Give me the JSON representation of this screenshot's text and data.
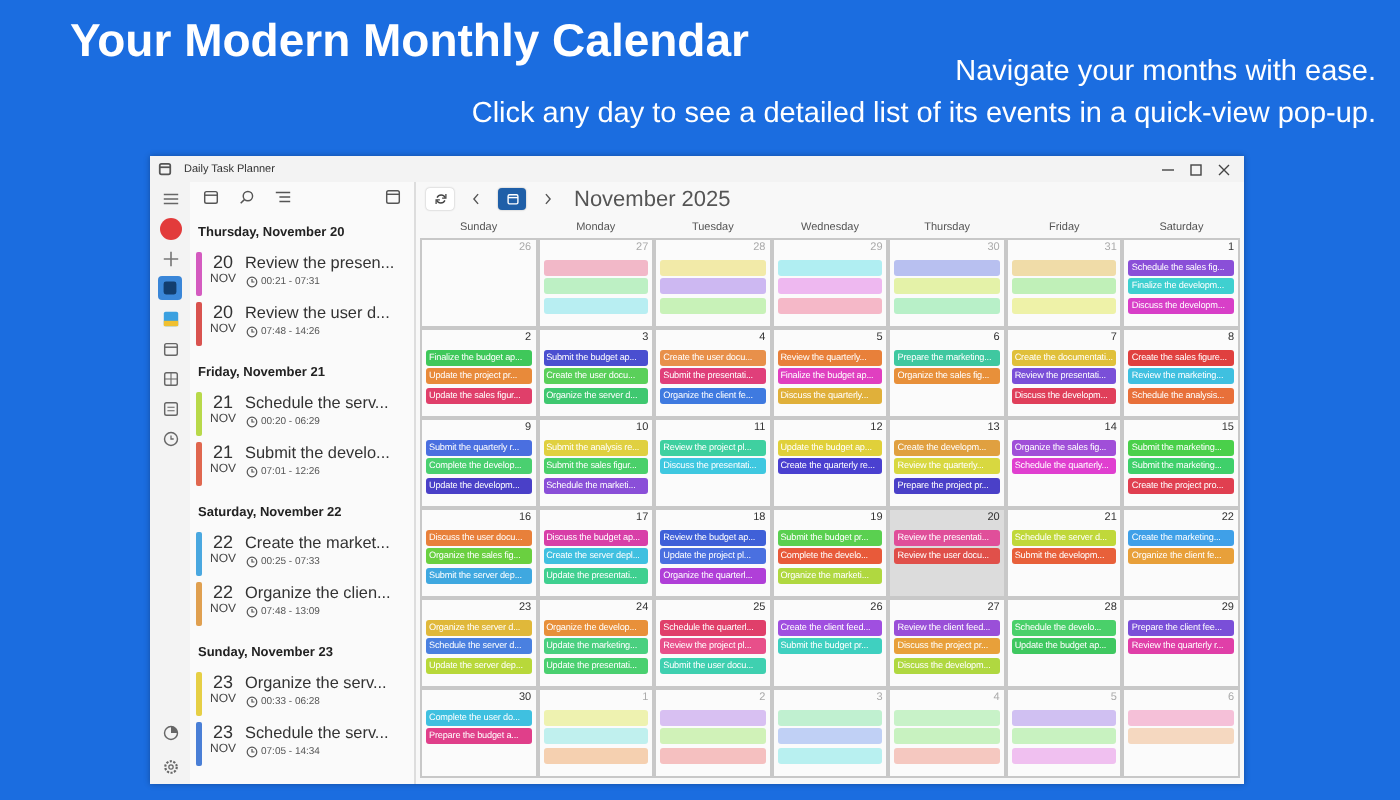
{
  "banner": {
    "title": "Your Modern Monthly Calendar",
    "lines": [
      "Navigate your months with ease.",
      "Click any day to see a detailed list of its events in a quick-view pop-up."
    ]
  },
  "window": {
    "title": "Daily Task Planner"
  },
  "rail": [
    {
      "kind": "menu",
      "selected": false
    },
    {
      "kind": "avatar",
      "selected": false
    },
    {
      "kind": "add",
      "selected": false
    },
    {
      "kind": "tile",
      "selected": true
    },
    {
      "kind": "image",
      "selected": false
    },
    {
      "kind": "calendar",
      "selected": false
    },
    {
      "kind": "grid",
      "selected": false
    },
    {
      "kind": "list",
      "selected": false
    },
    {
      "kind": "clock",
      "selected": false
    },
    {
      "kind": "chart",
      "selected": false
    }
  ],
  "agenda": [
    {
      "heading": "Thursday, November 20",
      "items": [
        {
          "day": "20",
          "month": "NOV",
          "title": "Review the presen...",
          "time": "00:21 - 07:31",
          "color": "#d45bc0"
        },
        {
          "day": "20",
          "month": "NOV",
          "title": "Review the user d...",
          "time": "07:48 - 14:26",
          "color": "#d9534f"
        }
      ]
    },
    {
      "heading": "Friday, November 21",
      "items": [
        {
          "day": "21",
          "month": "NOV",
          "title": "Schedule the serv...",
          "time": "00:20 - 06:29",
          "color": "#b8d94a"
        },
        {
          "day": "21",
          "month": "NOV",
          "title": "Submit the develo...",
          "time": "07:01 - 12:26",
          "color": "#e0674f"
        }
      ]
    },
    {
      "heading": "Saturday, November 22",
      "items": [
        {
          "day": "22",
          "month": "NOV",
          "title": "Create the market...",
          "time": "00:25 - 07:33",
          "color": "#4aa8e0"
        },
        {
          "day": "22",
          "month": "NOV",
          "title": "Organize the clien...",
          "time": "07:48 - 13:09",
          "color": "#e0a050"
        }
      ]
    },
    {
      "heading": "Sunday, November 23",
      "items": [
        {
          "day": "23",
          "month": "NOV",
          "title": "Organize the serv...",
          "time": "00:33 - 06:28",
          "color": "#e6cf45"
        },
        {
          "day": "23",
          "month": "NOV",
          "title": "Schedule the serv...",
          "time": "07:05 - 14:34",
          "color": "#4a7fd6"
        }
      ]
    }
  ],
  "calendar": {
    "month": "November 2025",
    "weekdays": [
      "Sunday",
      "Monday",
      "Tuesday",
      "Wednesday",
      "Thursday",
      "Friday",
      "Saturday"
    ],
    "weeks": [
      [
        {
          "date": "26",
          "muted": true,
          "selected": false
        },
        {
          "date": "27",
          "muted": true,
          "selected": false,
          "events": [
            {
              "color": "#f2b8c8"
            },
            {
              "color": "#bdf0c4"
            },
            {
              "color": "#b8eef2"
            }
          ]
        },
        {
          "date": "28",
          "muted": true,
          "selected": false,
          "events": [
            {
              "color": "#f2eaa8"
            },
            {
              "color": "#cdb8f2"
            },
            {
              "color": "#c8f2b8"
            }
          ]
        },
        {
          "date": "29",
          "muted": true,
          "selected": false,
          "events": [
            {
              "color": "#b0eef2"
            },
            {
              "color": "#eeb8f0"
            },
            {
              "color": "#f5b8c8"
            }
          ]
        },
        {
          "date": "30",
          "muted": true,
          "selected": false,
          "events": [
            {
              "color": "#b8c0f0"
            },
            {
              "color": "#e4f2a8"
            },
            {
              "color": "#b8f0c8"
            }
          ]
        },
        {
          "date": "31",
          "muted": true,
          "selected": false,
          "events": [
            {
              "color": "#f0dca8"
            },
            {
              "color": "#c0f0b8"
            },
            {
              "color": "#eef2a8"
            }
          ]
        },
        {
          "date": "1",
          "muted": false,
          "selected": false,
          "events": [
            {
              "text": "Schedule the sales fig...",
              "color": "#8a4fd8"
            },
            {
              "text": "Finalize the developm...",
              "color": "#3fd0d0"
            },
            {
              "text": "Discuss the developm...",
              "color": "#d83fc8"
            }
          ]
        }
      ],
      [
        {
          "date": "2",
          "muted": false,
          "selected": false,
          "events": [
            {
              "text": "Finalize the budget ap...",
              "color": "#3fc85a"
            },
            {
              "text": "Update the project pr...",
              "color": "#e88a3a"
            },
            {
              "text": "Update the sales figur...",
              "color": "#e03f6a"
            }
          ]
        },
        {
          "date": "3",
          "muted": false,
          "selected": false,
          "events": [
            {
              "text": "Submit the budget ap...",
              "color": "#4a4fd0"
            },
            {
              "text": "Create the user docu...",
              "color": "#5ad05a"
            },
            {
              "text": "Organize the server d...",
              "color": "#3fc870"
            }
          ]
        },
        {
          "date": "4",
          "muted": false,
          "selected": false,
          "events": [
            {
              "text": "Create the user docu...",
              "color": "#e8904a"
            },
            {
              "text": "Submit the presentati...",
              "color": "#e03f7a"
            },
            {
              "text": "Organize the client fe...",
              "color": "#3f7ae0"
            }
          ]
        },
        {
          "date": "5",
          "muted": false,
          "selected": false,
          "events": [
            {
              "text": "Review the quarterly...",
              "color": "#e8803a"
            },
            {
              "text": "Finalize the budget ap...",
              "color": "#e03fc0"
            },
            {
              "text": "Discuss the quarterly...",
              "color": "#e0b03a"
            }
          ]
        },
        {
          "date": "6",
          "muted": false,
          "selected": false,
          "events": [
            {
              "text": "Prepare the marketing...",
              "color": "#3fc8a0"
            },
            {
              "text": "Organize the sales fig...",
              "color": "#e8903a"
            }
          ]
        },
        {
          "date": "7",
          "muted": false,
          "selected": false,
          "events": [
            {
              "text": "Create the documentati...",
              "color": "#e0c03a"
            },
            {
              "text": "Review the presentati...",
              "color": "#7a4fd8"
            },
            {
              "text": "Discuss the developm...",
              "color": "#e03f5a"
            }
          ]
        },
        {
          "date": "8",
          "muted": false,
          "selected": false,
          "events": [
            {
              "text": "Create the sales figure...",
              "color": "#e0403f"
            },
            {
              "text": "Review the marketing...",
              "color": "#3fc0e0"
            },
            {
              "text": "Schedule the analysis...",
              "color": "#e8703a"
            }
          ]
        }
      ],
      [
        {
          "date": "9",
          "muted": false,
          "selected": false,
          "events": [
            {
              "text": "Submit the quarterly r...",
              "color": "#4a6fe0"
            },
            {
              "text": "Complete the develop...",
              "color": "#4ad070"
            },
            {
              "text": "Update the developm...",
              "color": "#4a40c8"
            }
          ]
        },
        {
          "date": "10",
          "muted": false,
          "selected": false,
          "events": [
            {
              "text": "Submit the analysis re...",
              "color": "#e0d040"
            },
            {
              "text": "Submit the sales figur...",
              "color": "#4ad06a"
            },
            {
              "text": "Schedule the marketi...",
              "color": "#8a4fd8"
            }
          ]
        },
        {
          "date": "11",
          "muted": false,
          "selected": false,
          "events": [
            {
              "text": "Review the project pl...",
              "color": "#3fd0a0"
            },
            {
              "text": "Discuss the presentati...",
              "color": "#3fc8e0"
            }
          ]
        },
        {
          "date": "12",
          "muted": false,
          "selected": false,
          "events": [
            {
              "text": "Update the budget ap...",
              "color": "#e0d03a"
            },
            {
              "text": "Create the quarterly re...",
              "color": "#4a40d0"
            }
          ]
        },
        {
          "date": "13",
          "muted": false,
          "selected": false,
          "events": [
            {
              "text": "Create the developm...",
              "color": "#e0a040"
            },
            {
              "text": "Review the quarterly...",
              "color": "#d8d840"
            },
            {
              "text": "Prepare the project pr...",
              "color": "#4a40c8"
            }
          ]
        },
        {
          "date": "14",
          "muted": false,
          "selected": false,
          "events": [
            {
              "text": "Organize the sales fig...",
              "color": "#a04fd8"
            },
            {
              "text": "Schedule the quarterly...",
              "color": "#e03fd0"
            }
          ]
        },
        {
          "date": "15",
          "muted": false,
          "selected": false,
          "events": [
            {
              "text": "Submit the marketing...",
              "color": "#4ad04a"
            },
            {
              "text": "Submit the marketing...",
              "color": "#3fd06a"
            },
            {
              "text": "Create the project pro...",
              "color": "#e03f50"
            }
          ]
        }
      ],
      [
        {
          "date": "16",
          "muted": false,
          "selected": false,
          "events": [
            {
              "text": "Discuss the user docu...",
              "color": "#e8803a"
            },
            {
              "text": "Organize the sales fig...",
              "color": "#6ad040"
            },
            {
              "text": "Submit the server dep...",
              "color": "#3fa8e0"
            }
          ]
        },
        {
          "date": "17",
          "muted": false,
          "selected": false,
          "events": [
            {
              "text": "Discuss the budget ap...",
              "color": "#d83fa8"
            },
            {
              "text": "Create the server depl...",
              "color": "#3fc0e0"
            },
            {
              "text": "Update the presentati...",
              "color": "#3fd090"
            }
          ]
        },
        {
          "date": "18",
          "muted": false,
          "selected": false,
          "events": [
            {
              "text": "Review the budget ap...",
              "color": "#3f60d8"
            },
            {
              "text": "Update the project pl...",
              "color": "#4a70e0"
            },
            {
              "text": "Organize the quarterl...",
              "color": "#b03fd8"
            }
          ]
        },
        {
          "date": "19",
          "muted": false,
          "selected": false,
          "events": [
            {
              "text": "Submit the budget pr...",
              "color": "#5ad050"
            },
            {
              "text": "Complete the develo...",
              "color": "#e85a3a"
            },
            {
              "text": "Organize the marketi...",
              "color": "#b0d840"
            }
          ]
        },
        {
          "date": "20",
          "muted": false,
          "selected": true,
          "events": [
            {
              "text": "Review the presentati...",
              "color": "#e04f9a"
            },
            {
              "text": "Review the user docu...",
              "color": "#e0504a"
            }
          ]
        },
        {
          "date": "21",
          "muted": false,
          "selected": false,
          "events": [
            {
              "text": "Schedule the server d...",
              "color": "#c0d83a"
            },
            {
              "text": "Submit the developm...",
              "color": "#e8603a"
            }
          ]
        },
        {
          "date": "22",
          "muted": false,
          "selected": false,
          "events": [
            {
              "text": "Create the marketing...",
              "color": "#3fa0e8"
            },
            {
              "text": "Organize the client fe...",
              "color": "#e8a03a"
            }
          ]
        }
      ],
      [
        {
          "date": "23",
          "muted": false,
          "selected": false,
          "events": [
            {
              "text": "Organize the server d...",
              "color": "#e0b83a"
            },
            {
              "text": "Schedule the server d...",
              "color": "#4a80e0"
            },
            {
              "text": "Update the server dep...",
              "color": "#b8d83a"
            }
          ]
        },
        {
          "date": "24",
          "muted": false,
          "selected": false,
          "events": [
            {
              "text": "Organize the develop...",
              "color": "#e8903a"
            },
            {
              "text": "Update the marketing...",
              "color": "#4ad080"
            },
            {
              "text": "Update the presentati...",
              "color": "#4ad070"
            }
          ]
        },
        {
          "date": "25",
          "muted": false,
          "selected": false,
          "events": [
            {
              "text": "Schedule the quarterl...",
              "color": "#e03f6a"
            },
            {
              "text": "Review the project pl...",
              "color": "#e84f8a"
            },
            {
              "text": "Submit the user docu...",
              "color": "#3fd0b0"
            }
          ]
        },
        {
          "date": "26",
          "muted": false,
          "selected": false,
          "events": [
            {
              "text": "Create the client feed...",
              "color": "#a04fe0"
            },
            {
              "text": "Submit the budget pr...",
              "color": "#3fd0c0"
            }
          ]
        },
        {
          "date": "27",
          "muted": false,
          "selected": false,
          "events": [
            {
              "text": "Review the client feed...",
              "color": "#9a4fd8"
            },
            {
              "text": "Discuss the project pr...",
              "color": "#e8a03a"
            },
            {
              "text": "Discuss the developm...",
              "color": "#b0d840"
            }
          ]
        },
        {
          "date": "28",
          "muted": false,
          "selected": false,
          "events": [
            {
              "text": "Schedule the develo...",
              "color": "#4ad06a"
            },
            {
              "text": "Update the budget ap...",
              "color": "#3fc860"
            }
          ]
        },
        {
          "date": "29",
          "muted": false,
          "selected": false,
          "events": [
            {
              "text": "Prepare the client fee...",
              "color": "#7a4fd8"
            },
            {
              "text": "Review the quarterly r...",
              "color": "#e03fa8"
            }
          ]
        }
      ],
      [
        {
          "date": "30",
          "muted": false,
          "selected": false,
          "events": [
            {
              "text": "Complete the user do...",
              "color": "#3fc0e0"
            },
            {
              "text": "Prepare the budget a...",
              "color": "#e03f8a"
            }
          ]
        },
        {
          "date": "1",
          "muted": true,
          "selected": false,
          "events": [
            {
              "color": "#eef2b0"
            },
            {
              "color": "#c0f0ee"
            },
            {
              "color": "#f5d0b0"
            }
          ]
        },
        {
          "date": "2",
          "muted": true,
          "selected": false,
          "events": [
            {
              "color": "#d8c0f2"
            },
            {
              "color": "#d0f2b8"
            },
            {
              "color": "#f5c0c0"
            }
          ]
        },
        {
          "date": "3",
          "muted": true,
          "selected": false,
          "events": [
            {
              "color": "#c0f0d0"
            },
            {
              "color": "#c0d0f5"
            },
            {
              "color": "#b8f0f0"
            }
          ]
        },
        {
          "date": "4",
          "muted": true,
          "selected": false,
          "events": [
            {
              "color": "#c8f2c8"
            },
            {
              "color": "#c8f2c0"
            },
            {
              "color": "#f5c8c0"
            }
          ]
        },
        {
          "date": "5",
          "muted": true,
          "selected": false,
          "events": [
            {
              "color": "#d0c0f2"
            },
            {
              "color": "#c8f2c0"
            },
            {
              "color": "#f0c0f0"
            }
          ]
        },
        {
          "date": "6",
          "muted": true,
          "selected": false,
          "events": [
            {
              "color": "#f5c0d8"
            },
            {
              "color": "#f5d8c0"
            }
          ]
        }
      ]
    ]
  }
}
